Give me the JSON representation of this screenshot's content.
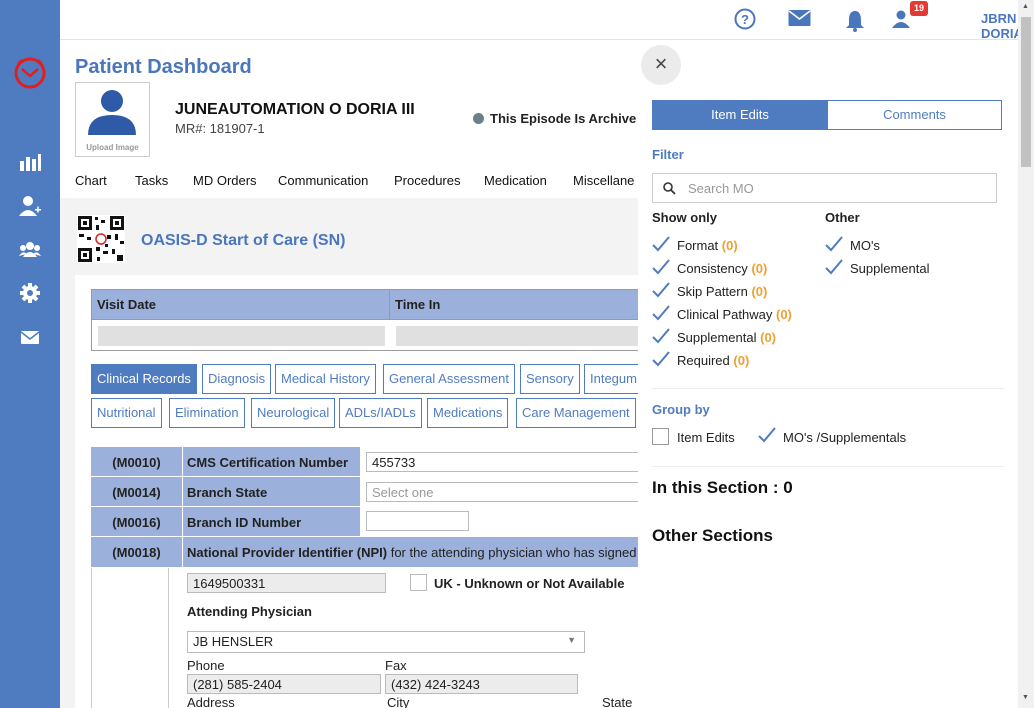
{
  "app": {
    "username": "JBRN DORIA",
    "notification_count": "19"
  },
  "sidebar": {
    "items": [
      {
        "icon": "bar-chart-icon"
      },
      {
        "icon": "user-add-icon"
      },
      {
        "icon": "group-icon"
      },
      {
        "icon": "gear-icon"
      },
      {
        "icon": "mail-icon"
      }
    ]
  },
  "header": {
    "page_title": "Patient Dashboard",
    "upload_label": "Upload Image",
    "patient_name": "JUNEAUTOMATION O DORIA III",
    "mr": "MR#: 181907-1",
    "episode_status": "This Episode Is Archive"
  },
  "nav_tabs": [
    "Chart",
    "Tasks",
    "MD Orders",
    "Communication",
    "Procedures",
    "Medication",
    "Miscellane"
  ],
  "form": {
    "title": "OASIS-D Start of Care (SN)",
    "visit_date_label": "Visit Date",
    "time_in_label": "Time In",
    "section_tabs_row1": [
      "Clinical Records",
      "Diagnosis",
      "Medical History",
      "General Assessment",
      "Sensory",
      "Integum"
    ],
    "section_tabs_row2": [
      "Nutritional",
      "Elimination",
      "Neurological",
      "ADLs/IADLs",
      "Medications",
      "Care Management"
    ],
    "rows": [
      {
        "code": "(M0010)",
        "label": "CMS Certification Number",
        "value": "455733"
      },
      {
        "code": "(M0014)",
        "label": "Branch State",
        "value": "Select one"
      },
      {
        "code": "(M0016)",
        "label": "Branch ID Number",
        "value": ""
      },
      {
        "code": "(M0018)",
        "label": "National Provider Identifier (NPI)",
        "label_rest": " for the attending physician who has signed"
      }
    ],
    "npi_value": "1649500331",
    "uk_label": "UK - Unknown or Not Available",
    "attending_physician_label": "Attending Physician",
    "attending_physician_value": "JB HENSLER",
    "phone_label": "Phone",
    "phone_value": "(281) 585-2404",
    "fax_label": "Fax",
    "fax_value": "(432) 424-3243",
    "address_label": "Address",
    "city_label": "City",
    "state_label": "State"
  },
  "panel": {
    "tab_item_edits": "Item Edits",
    "tab_comments": "Comments",
    "filter_label": "Filter",
    "search_placeholder": "Search MO",
    "show_only_label": "Show only",
    "other_label": "Other",
    "show_only": [
      {
        "label": "Format",
        "count": "(0)"
      },
      {
        "label": "Consistency",
        "count": "(0)"
      },
      {
        "label": "Skip Pattern",
        "count": "(0)"
      },
      {
        "label": "Clinical Pathway",
        "count": "(0)"
      },
      {
        "label": "Supplemental",
        "count": "(0)"
      },
      {
        "label": "Required",
        "count": "(0)"
      }
    ],
    "other": [
      "MO's",
      "Supplemental"
    ],
    "group_by_label": "Group by",
    "group_item_edits": "Item Edits",
    "group_mos": "MO's /Supplementals",
    "in_this_section": "In this Section : 0",
    "other_sections": "Other Sections"
  },
  "colors": {
    "accent": "#4f7cc0",
    "header_cell": "#9bb0da",
    "count": "#f0a030",
    "badge": "#e53935"
  }
}
